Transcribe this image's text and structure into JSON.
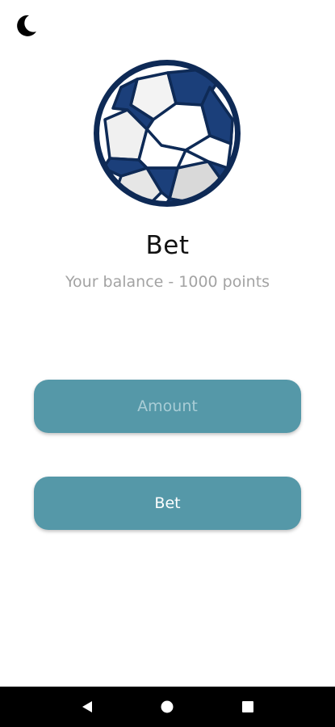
{
  "header": {
    "theme_icon": "moon-icon"
  },
  "hero": {
    "image_icon": "soccer-ball-icon",
    "colors": {
      "navy": "#1b3f7a",
      "outline": "#0e2a56",
      "white_panel": "#ffffff",
      "grey_panel": "#d9d9d9"
    }
  },
  "main": {
    "title": "Bet",
    "balance_text": "Your balance - 1000 points",
    "amount_input": {
      "value": "",
      "placeholder": "Amount"
    },
    "bet_button_label": "Bet"
  },
  "theme": {
    "accent": "#5598a8",
    "title_color": "#111111",
    "subtitle_color": "#a3a3a3"
  },
  "navbar": {
    "back_icon": "back-triangle-icon",
    "home_icon": "home-circle-icon",
    "recents_icon": "recents-square-icon"
  }
}
